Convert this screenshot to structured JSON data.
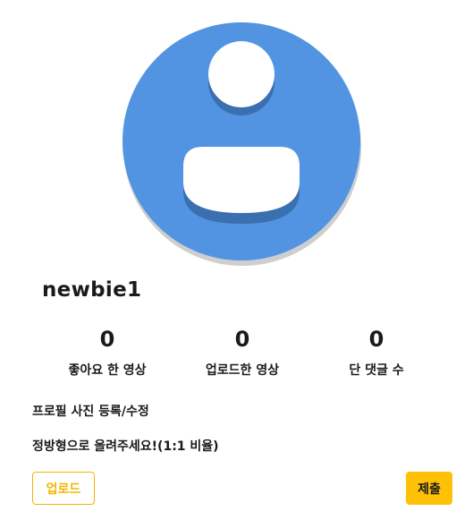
{
  "profile": {
    "username": "newbie1",
    "avatar_icon": "default-user-avatar-icon",
    "avatar_color": "#5294e2"
  },
  "stats": [
    {
      "value": "0",
      "label": "좋아요 한 영상"
    },
    {
      "value": "0",
      "label": "업로드한 영상"
    },
    {
      "value": "0",
      "label": "단 댓글 수"
    }
  ],
  "photo_section": {
    "title": "프로필 사진 등록/수정",
    "hint": "정방형으로 올려주세요!(1:1 비율)",
    "upload_label": "업로드",
    "submit_label": "제출"
  },
  "colors": {
    "accent": "#ffc107",
    "upload_border": "#f5b400"
  }
}
